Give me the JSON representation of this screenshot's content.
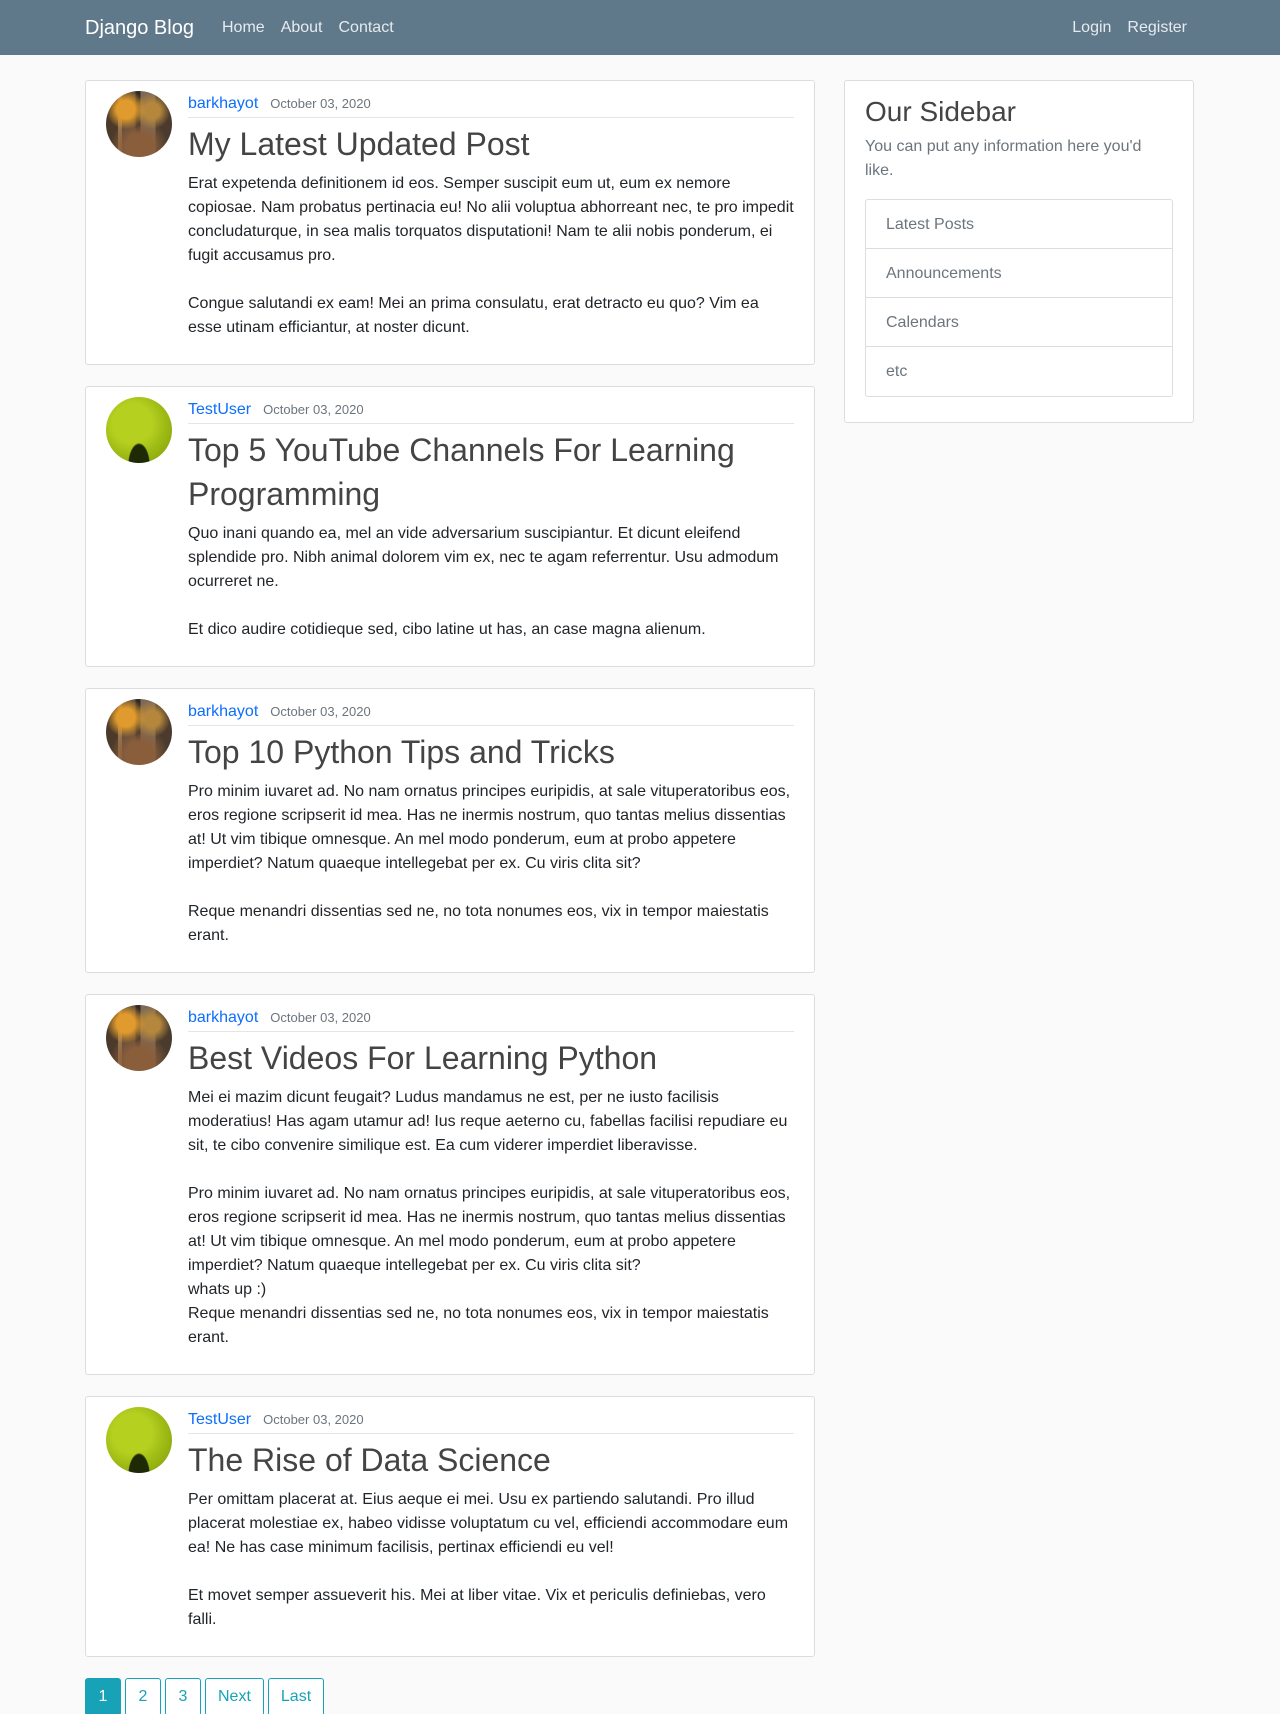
{
  "navbar": {
    "brand": "Django Blog",
    "left_links": [
      "Home",
      "About",
      "Contact"
    ],
    "right_links": [
      "Login",
      "Register"
    ]
  },
  "posts": [
    {
      "author": "barkhayot",
      "avatar": "autumn-park-avatar",
      "date": "October 03, 2020",
      "title": "My Latest Updated Post",
      "paragraphs": [
        "Erat expetenda definitionem id eos. Semper suscipit eum ut, eum ex nemore copiosae. Nam probatus pertinacia eu! No alii voluptua abhorreant nec, te pro impedit concludaturque, in sea malis torquatos disputationi! Nam te alii nobis ponderum, ei fugit accusamus pro.",
        "Congue salutandi ex eam! Mei an prima consulatu, erat detracto eu quo? Vim ea esse utinam efficiantur, at noster dicunt."
      ]
    },
    {
      "author": "TestUser",
      "avatar": "green-ball-avatar",
      "date": "October 03, 2020",
      "title": "Top 5 YouTube Channels For Learning Programming",
      "paragraphs": [
        "Quo inani quando ea, mel an vide adversarium suscipiantur. Et dicunt eleifend splendide pro. Nibh animal dolorem vim ex, nec te agam referrentur. Usu admodum ocurreret ne.",
        "Et dico audire cotidieque sed, cibo latine ut has, an case magna alienum."
      ]
    },
    {
      "author": "barkhayot",
      "avatar": "autumn-park-avatar",
      "date": "October 03, 2020",
      "title": "Top 10 Python Tips and Tricks",
      "paragraphs": [
        "Pro minim iuvaret ad. No nam ornatus principes euripidis, at sale vituperatoribus eos, eros regione scripserit id mea. Has ne inermis nostrum, quo tantas melius dissentias at! Ut vim tibique omnesque. An mel modo ponderum, eum at probo appetere imperdiet? Natum quaeque intellegebat per ex. Cu viris clita sit?",
        "Reque menandri dissentias sed ne, no tota nonumes eos, vix in tempor maiestatis erant."
      ]
    },
    {
      "author": "barkhayot",
      "avatar": "autumn-park-avatar",
      "date": "October 03, 2020",
      "title": "Best Videos For Learning Python",
      "paragraphs": [
        "Mei ei mazim dicunt feugait? Ludus mandamus ne est, per ne iusto facilisis moderatius! Has agam utamur ad! Ius reque aeterno cu, fabellas facilisi repudiare eu sit, te cibo convenire similique est. Ea cum viderer imperdiet liberavisse.",
        "Pro minim iuvaret ad. No nam ornatus principes euripidis, at sale vituperatoribus eos, eros regione scripserit id mea. Has ne inermis nostrum, quo tantas melius dissentias at! Ut vim tibique omnesque. An mel modo ponderum, eum at probo appetere imperdiet? Natum quaeque intellegebat per ex. Cu viris clita sit?\nwhats up :)\nReque menandri dissentias sed ne, no tota nonumes eos, vix in tempor maiestatis erant."
      ]
    },
    {
      "author": "TestUser",
      "avatar": "green-ball-avatar",
      "date": "October 03, 2020",
      "title": "The Rise of Data Science",
      "paragraphs": [
        "Per omittam placerat at. Eius aeque ei mei. Usu ex partiendo salutandi. Pro illud placerat molestiae ex, habeo vidisse voluptatum cu vel, efficiendi accommodare eum ea! Ne has case minimum facilisis, pertinax efficiendi eu vel!",
        "Et movet semper assueverit his. Mei at liber vitae. Vix et periculis definiebas, vero falli."
      ]
    }
  ],
  "pagination": {
    "buttons": [
      "1",
      "2",
      "3",
      "Next",
      "Last"
    ],
    "active": "1"
  },
  "sidebar": {
    "title": "Our Sidebar",
    "text": "You can put any information here you'd like.",
    "items": [
      "Latest Posts",
      "Announcements",
      "Calendars",
      "etc"
    ]
  },
  "colors": {
    "navbar": "#5f788a",
    "link": "#0d6efd",
    "pagination": "#17a2b8"
  }
}
